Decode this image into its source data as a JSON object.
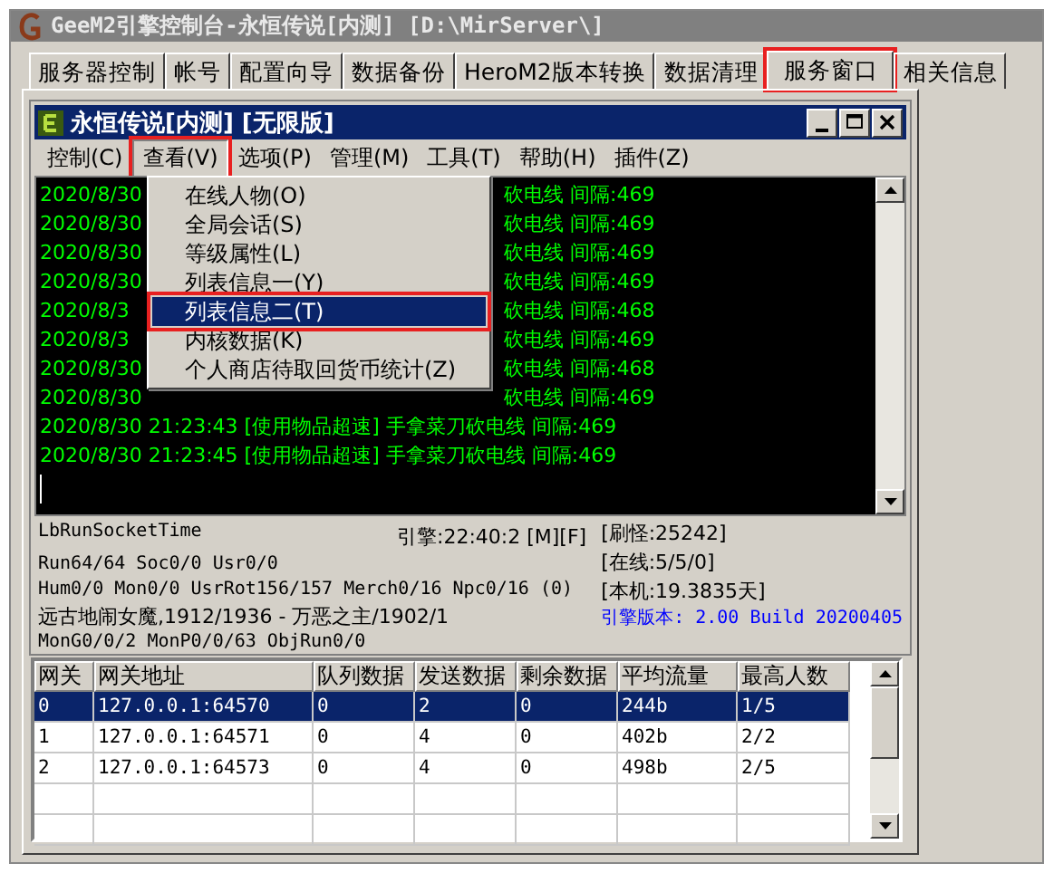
{
  "window": {
    "title": "GeeM2引擎控制台-永恒传说[内测] [D:\\MirServer\\]"
  },
  "tabs": [
    {
      "label": "服务器控制",
      "selected": false,
      "highlighted": false
    },
    {
      "label": "帐号",
      "selected": false,
      "highlighted": false
    },
    {
      "label": "配置向导",
      "selected": false,
      "highlighted": false
    },
    {
      "label": "数据备份",
      "selected": false,
      "highlighted": false
    },
    {
      "label": "HeroM2版本转换",
      "selected": false,
      "highlighted": false
    },
    {
      "label": "数据清理",
      "selected": false,
      "highlighted": false
    },
    {
      "label": "服务窗口",
      "selected": true,
      "highlighted": true
    },
    {
      "label": "相关信息",
      "selected": false,
      "highlighted": false
    }
  ],
  "console": {
    "title": "永恒传说[内测] [无限版]",
    "menu": [
      {
        "label": "控制(C)",
        "open": false,
        "highlighted": false
      },
      {
        "label": "查看(V)",
        "open": true,
        "highlighted": true
      },
      {
        "label": "选项(P)",
        "open": false,
        "highlighted": false
      },
      {
        "label": "管理(M)",
        "open": false,
        "highlighted": false
      },
      {
        "label": "工具(T)",
        "open": false,
        "highlighted": false
      },
      {
        "label": "帮助(H)",
        "open": false,
        "highlighted": false
      },
      {
        "label": "插件(Z)",
        "open": false,
        "highlighted": false
      }
    ],
    "dropdown": [
      {
        "label": "在线人物(O)",
        "selected": false,
        "highlighted": false
      },
      {
        "label": "全局会话(S)",
        "selected": false,
        "highlighted": false
      },
      {
        "label": "等级属性(L)",
        "selected": false,
        "highlighted": false
      },
      {
        "label": "列表信息一(Y)",
        "selected": false,
        "highlighted": false
      },
      {
        "label": "列表信息二(T)",
        "selected": true,
        "highlighted": true
      },
      {
        "label": "内核数据(K)",
        "selected": false,
        "highlighted": false
      },
      {
        "label": "个人商店待取回货币统计(Z)",
        "selected": false,
        "highlighted": false
      }
    ],
    "log": [
      {
        "left": "2020/8/30",
        "right": "砍电线 间隔:469"
      },
      {
        "left": "2020/8/30",
        "right": "砍电线 间隔:469"
      },
      {
        "left": "2020/8/30",
        "right": "砍电线 间隔:469"
      },
      {
        "left": "2020/8/30",
        "right": "砍电线 间隔:469"
      },
      {
        "left": "2020/8/3",
        "right": "砍电线 间隔:468"
      },
      {
        "left": "2020/8/3",
        "right": "砍电线 间隔:469"
      },
      {
        "left": "2020/8/30",
        "right": "砍电线 间隔:468"
      },
      {
        "left": "2020/8/30",
        "right": "砍电线 间隔:469"
      },
      {
        "text": "2020/8/30 21:23:43 [使用物品超速] 手拿菜刀砍电线 间隔:469"
      },
      {
        "text": "2020/8/30 21:23:45 [使用物品超速] 手拿菜刀砍电线 间隔:469"
      }
    ],
    "status": {
      "left": [
        "LbRunSocketTime",
        "Run64/64 Soc0/0 Usr0/0",
        "Hum0/0 Mon0/0 UsrRot156/157 Merch0/16 Npc0/16 (0)",
        "远古地闹女魔,1912/1936 - 万恶之主/1902/1",
        "MonG0/0/2 MonP0/0/63 ObjRun0/0"
      ],
      "engine": "引擎:22:40:2 [M][F]",
      "right": [
        "[刷怪:25242]",
        "[在线:5/5/0]",
        "[本机:19.3835天]"
      ],
      "version": "引擎版本: 2.00 Build 20200405"
    }
  },
  "table": {
    "columns": [
      "网关",
      "网关地址",
      "队列数据",
      "发送数据",
      "剩余数据",
      "平均流量",
      "最高人数"
    ],
    "rows": [
      {
        "selected": true,
        "cells": [
          "0",
          "127.0.0.1:64570",
          "0",
          "2",
          "0",
          "244b",
          "1/5"
        ]
      },
      {
        "selected": false,
        "cells": [
          "1",
          "127.0.0.1:64571",
          "0",
          "4",
          "0",
          "402b",
          "2/2"
        ]
      },
      {
        "selected": false,
        "cells": [
          "2",
          "127.0.0.1:64573",
          "0",
          "4",
          "0",
          "498b",
          "2/5"
        ]
      }
    ]
  }
}
